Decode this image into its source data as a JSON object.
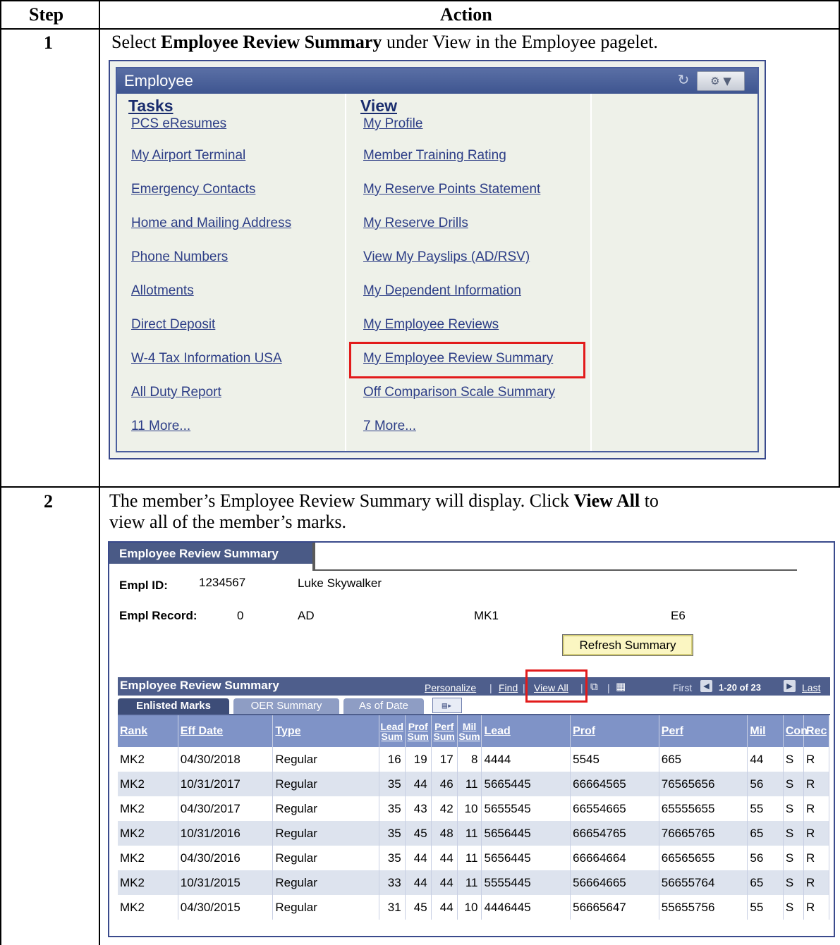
{
  "table": {
    "header_step": "Step",
    "header_action": "Action"
  },
  "step1": {
    "number": "1",
    "text_before": "Select ",
    "text_bold": "Employee Review Summary",
    "text_after": " under View in the Employee pagelet."
  },
  "pagelet": {
    "title": "Employee",
    "tasks_heading": "Tasks",
    "view_heading": "View",
    "tasks": [
      "PCS eResumes",
      "My Airport Terminal",
      "Emergency Contacts",
      "Home and Mailing Address",
      "Phone Numbers",
      "Allotments",
      "Direct Deposit",
      "W-4 Tax Information USA",
      "All Duty Report",
      "11 More..."
    ],
    "view": [
      "My Profile",
      "Member Training Rating",
      "My Reserve Points Statement",
      "My Reserve Drills",
      "View My Payslips (AD/RSV)",
      "My Dependent Information",
      "My Employee Reviews",
      "My Employee Review Summary",
      "Off Comparison Scale Summary",
      "7 More..."
    ],
    "highlight_color": "#e21b1b"
  },
  "step2": {
    "number": "2",
    "line1_before": "The member’s Employee Review Summary will display.  Click ",
    "line1_bold": "View All",
    "line1_after": " to",
    "line2": "view all of the member’s marks."
  },
  "summary": {
    "tab_title": "Employee Review Summary",
    "empl_id_label": "Empl ID:",
    "empl_id": "1234567",
    "name": "Luke Skywalker",
    "empl_record_label": "Empl Record:",
    "empl_record": "0",
    "component": "AD",
    "rate": "MK1",
    "grade": "E6",
    "refresh_button": "Refresh Summary",
    "grid_title": "Employee Review Summary",
    "nav": {
      "personalize": "Personalize",
      "find": "Find",
      "view_all": "View All",
      "first": "First",
      "range": "1-20 of 23",
      "last": "Last"
    },
    "subtabs": [
      "Enlisted Marks",
      "OER Summary",
      "As of Date"
    ],
    "columns": [
      "Rank",
      "Eff Date",
      "Type",
      "Lead Sum",
      "Prof Sum",
      "Perf Sum",
      "Mil Sum",
      "Lead",
      "Prof",
      "Perf",
      "Mil",
      "Con",
      "Rec"
    ],
    "rows": [
      [
        "MK2",
        "04/30/2018",
        "Regular",
        "16",
        "19",
        "17",
        "8",
        "4444",
        "5545",
        "665",
        "44",
        "S",
        "R"
      ],
      [
        "MK2",
        "10/31/2017",
        "Regular",
        "35",
        "44",
        "46",
        "11",
        "5665445",
        "66664565",
        "76565656",
        "56",
        "S",
        "R"
      ],
      [
        "MK2",
        "04/30/2017",
        "Regular",
        "35",
        "43",
        "42",
        "10",
        "5655545",
        "66554665",
        "65555655",
        "55",
        "S",
        "R"
      ],
      [
        "MK2",
        "10/31/2016",
        "Regular",
        "35",
        "45",
        "48",
        "11",
        "5656445",
        "66654765",
        "76665765",
        "65",
        "S",
        "R"
      ],
      [
        "MK2",
        "04/30/2016",
        "Regular",
        "35",
        "44",
        "44",
        "11",
        "5656445",
        "66664664",
        "66565655",
        "56",
        "S",
        "R"
      ],
      [
        "MK2",
        "10/31/2015",
        "Regular",
        "33",
        "44",
        "44",
        "11",
        "5555445",
        "56664665",
        "56655764",
        "65",
        "S",
        "R"
      ],
      [
        "MK2",
        "04/30/2015",
        "Regular",
        "31",
        "45",
        "44",
        "10",
        "4446445",
        "56665647",
        "55655756",
        "55",
        "S",
        "R"
      ]
    ]
  }
}
